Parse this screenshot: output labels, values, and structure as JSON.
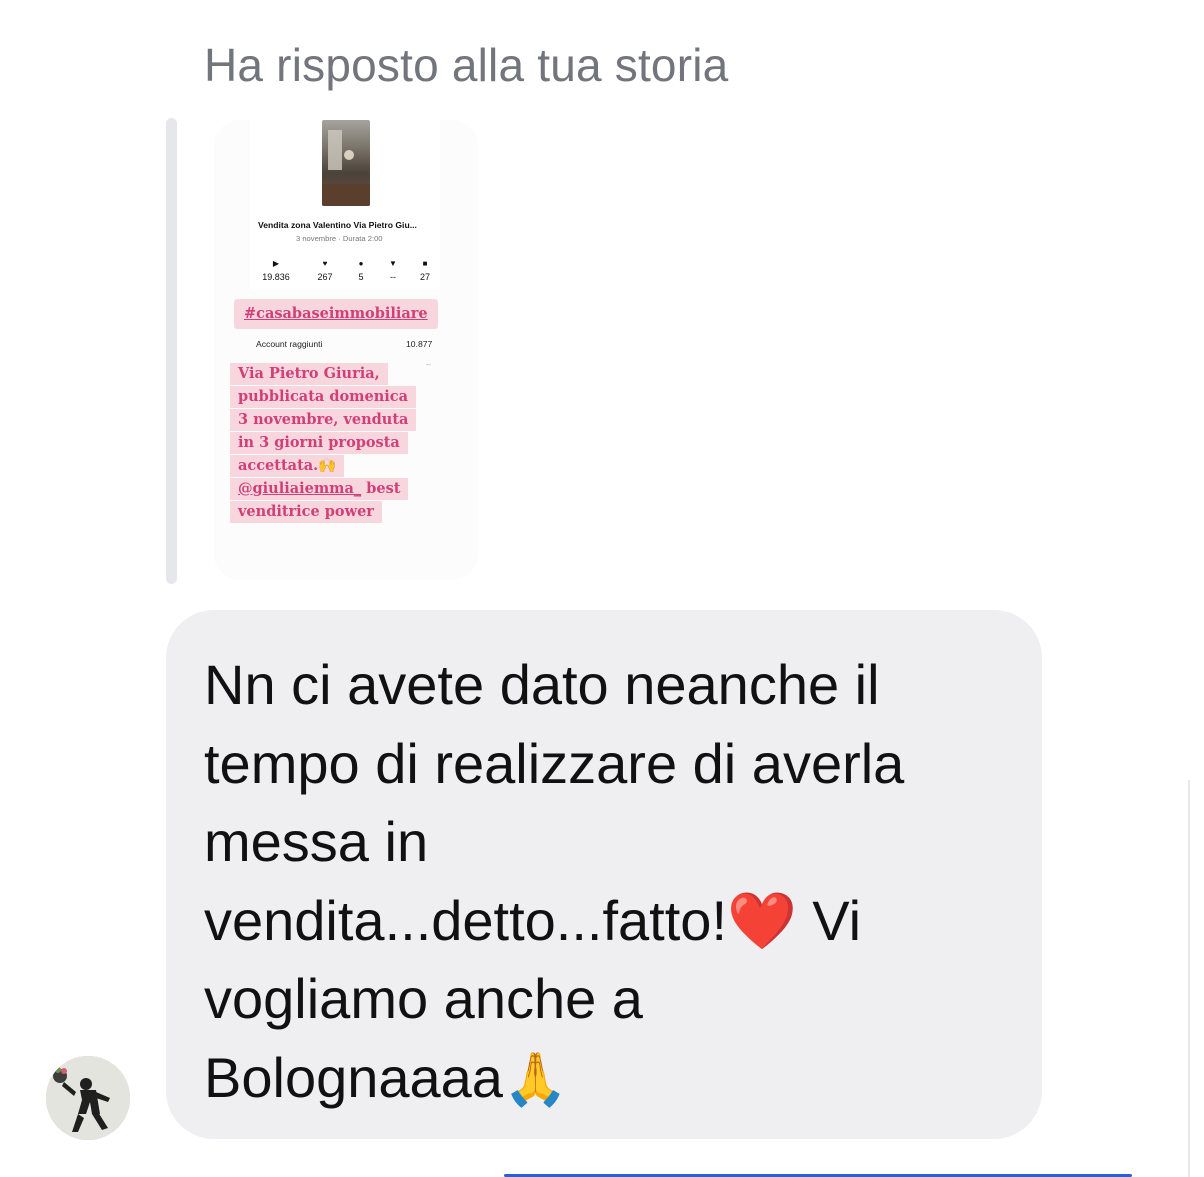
{
  "reply_header": "Ha risposto alla tua storia",
  "story": {
    "post_title": "Vendita zona Valentino Via Pietro Giu...",
    "post_meta": "3 novembre · Durata 2:00",
    "stats": [
      {
        "icon": "play-icon",
        "glyph": "▶",
        "value": "19.836"
      },
      {
        "icon": "heart-icon",
        "glyph": "♥",
        "value": "267"
      },
      {
        "icon": "comment-icon",
        "glyph": "●",
        "value": "5"
      },
      {
        "icon": "share-icon",
        "glyph": "▼",
        "value": "--"
      },
      {
        "icon": "bookmark-icon",
        "glyph": "■",
        "value": "27"
      }
    ],
    "hashtag": "#casabaseimmobiliare",
    "accounts_label": "Account raggiunti",
    "accounts_value": "10.877",
    "small_dash": "--",
    "caption_lines": [
      "Via Pietro Giuria,",
      "pubblicata domenica",
      "3 novembre, venduta",
      "in 3 giorni proposta",
      "accettata.🙌"
    ],
    "mention": "@giuliaiemma_",
    "mention_suffix": " best",
    "caption_last": "venditrice power"
  },
  "message": {
    "line1": "Nn ci avete dato neanche il",
    "line2": "tempo di realizzare di averla",
    "line3": "messa in",
    "line4a": "vendita...detto...fatto!",
    "line4_emoji": "❤️",
    "line4b": " Vi",
    "line5": "vogliamo anche a",
    "line6a": "Bolognaaaa",
    "line6_emoji": "🙏"
  },
  "colors": {
    "bubble_bg": "#efeff2",
    "header_text": "#72757c",
    "caption_pink": "#d23f78",
    "caption_bg": "#f7d7dd",
    "bottom_indicator": "#2b5fd8"
  }
}
